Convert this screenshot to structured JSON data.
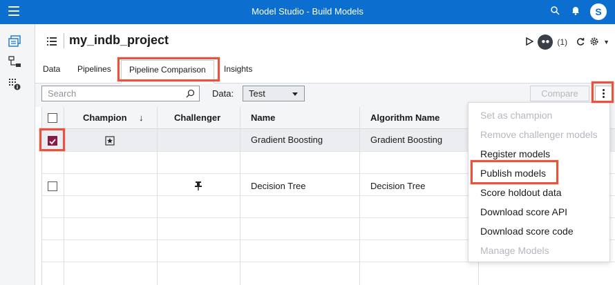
{
  "app": {
    "title": "Model Studio - Build Models",
    "avatar_initial": "S"
  },
  "project": {
    "name": "my_indb_project",
    "run_count": "(1)"
  },
  "tabs": [
    "Data",
    "Pipelines",
    "Pipeline Comparison",
    "Insights"
  ],
  "active_tab": "Pipeline Comparison",
  "toolbar": {
    "search_placeholder": "Search",
    "data_label": "Data:",
    "data_value": "Test",
    "compare_label": "Compare"
  },
  "grid": {
    "headers": {
      "champion": "Champion",
      "challenger": "Challenger",
      "name": "Name",
      "algorithm": "Algorithm Name",
      "sort_arrow": "↓"
    },
    "rows": [
      {
        "name": "Gradient Boosting",
        "algorithm": "Gradient Boosting",
        "checked": true,
        "champion": true,
        "challenger": false
      },
      {
        "name": "Decision Tree",
        "algorithm": "Decision Tree",
        "checked": false,
        "champion": false,
        "challenger": true
      }
    ]
  },
  "menu": {
    "items": [
      {
        "label": "Set as champion",
        "enabled": false
      },
      {
        "label": "Remove challenger models",
        "enabled": false
      },
      {
        "label": "Register models",
        "enabled": true
      },
      {
        "label": "Publish models",
        "enabled": true
      },
      {
        "label": "Score holdout data",
        "enabled": true
      },
      {
        "label": "Download score API",
        "enabled": true
      },
      {
        "label": "Download score code",
        "enabled": true
      },
      {
        "label": "Manage Models",
        "enabled": false
      }
    ]
  },
  "colors": {
    "topbar": "#0c6fd0",
    "callout": "#e8533f",
    "checked": "#8a1a44"
  },
  "icons": [
    "hamburger-icon",
    "search-icon",
    "bell-icon",
    "project-list-icon",
    "run-icon",
    "team-icon",
    "refresh-icon",
    "gear-icon",
    "champion-star-icon",
    "challenger-pin-icon",
    "kebab-icon"
  ]
}
